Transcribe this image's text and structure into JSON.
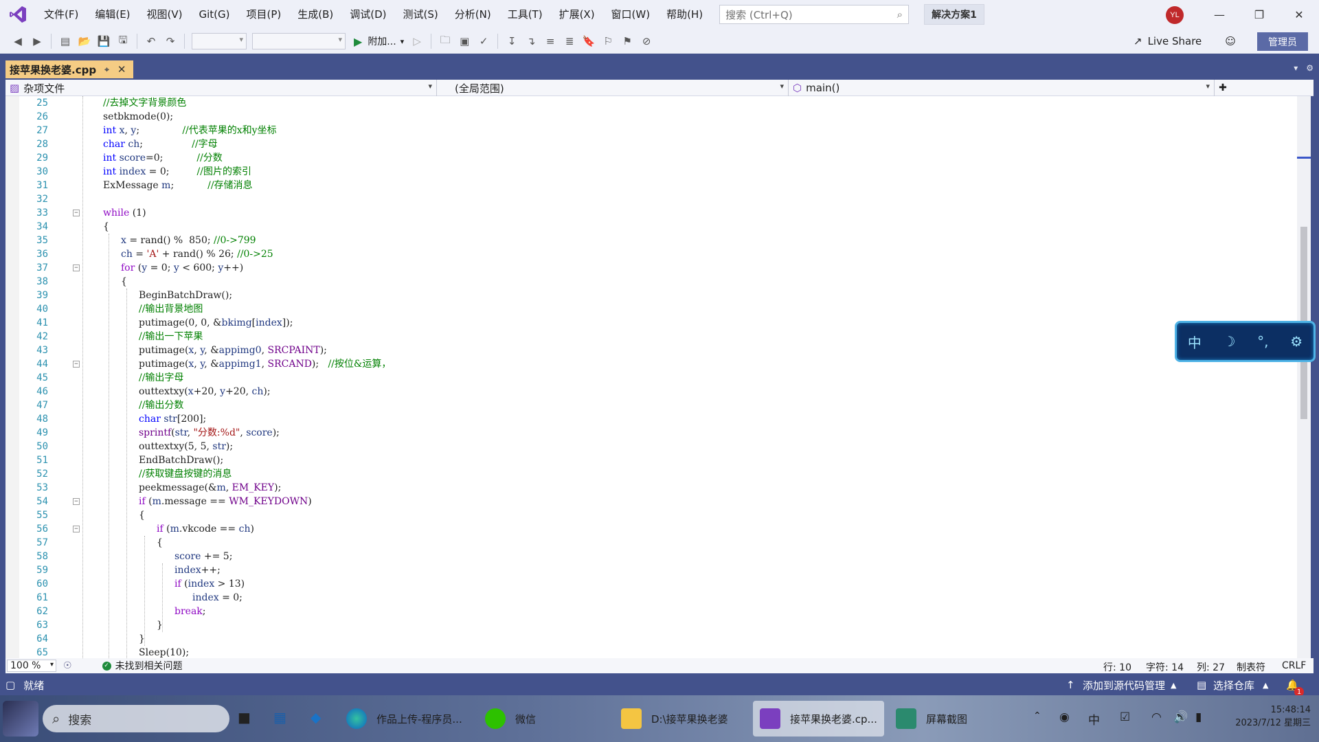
{
  "menu": [
    "文件(F)",
    "编辑(E)",
    "视图(V)",
    "Git(G)",
    "项目(P)",
    "生成(B)",
    "调试(D)",
    "测试(S)",
    "分析(N)",
    "工具(T)",
    "扩展(X)",
    "窗口(W)",
    "帮助(H)"
  ],
  "search": {
    "placeholder": "搜索 (Ctrl+Q)"
  },
  "solution": "解决方案1",
  "user_initials": "YL",
  "toolbar": {
    "attach_label": "附加...",
    "live_share": "Live Share",
    "admin": "管理员"
  },
  "tab": {
    "filename": "接苹果换老婆.cpp"
  },
  "navbar": {
    "project": "杂项文件",
    "scope": "(全局范围)",
    "member": "main()"
  },
  "editor": {
    "lines": [
      {
        "n": "25",
        "fold": false,
        "html": "<span class=\"cm\">//去掉文字背景颜色</span>",
        "indent": 0
      },
      {
        "n": "26",
        "fold": false,
        "html": "setbkmode(0);",
        "indent": 0
      },
      {
        "n": "27",
        "fold": false,
        "html": "<span class=\"kw\">int</span> <span class=\"var\">x</span>, <span class=\"var\">y</span>;              <span class=\"cm\">//代表苹果的x和y坐标</span>",
        "indent": 0
      },
      {
        "n": "28",
        "fold": false,
        "html": "<span class=\"kw\">char</span> <span class=\"var\">ch</span>;                <span class=\"cm\">//字母</span>",
        "indent": 0
      },
      {
        "n": "29",
        "fold": false,
        "html": "<span class=\"kw\">int</span> <span class=\"var\">score</span>=0;           <span class=\"cm\">//分数</span>",
        "indent": 0
      },
      {
        "n": "30",
        "fold": false,
        "html": "<span class=\"kw\">int</span> <span class=\"var\">index</span> = 0;         <span class=\"cm\">//图片的索引</span>",
        "indent": 0
      },
      {
        "n": "31",
        "fold": false,
        "html": "ExMessage <span class=\"var\">m</span>;           <span class=\"cm\">//存储消息</span>",
        "indent": 0
      },
      {
        "n": "32",
        "fold": false,
        "html": "",
        "indent": 0
      },
      {
        "n": "33",
        "fold": true,
        "html": "<span class=\"kw2\">while</span> (1)",
        "indent": 0
      },
      {
        "n": "34",
        "fold": false,
        "html": "{",
        "indent": 0
      },
      {
        "n": "35",
        "fold": false,
        "html": "<span class=\"var\">x</span> = rand() %  850; <span class=\"cm\">//0-&gt;799</span>",
        "indent": 1
      },
      {
        "n": "36",
        "fold": false,
        "html": "<span class=\"var\">ch</span> = <span class=\"str\">'A'</span> + rand() % 26; <span class=\"cm\">//0-&gt;25</span>",
        "indent": 1
      },
      {
        "n": "37",
        "fold": true,
        "html": "<span class=\"kw2\">for</span> (<span class=\"var\">y</span> = 0; <span class=\"var\">y</span> &lt; 600; <span class=\"var\">y</span>++)",
        "indent": 1
      },
      {
        "n": "38",
        "fold": false,
        "html": "{",
        "indent": 1
      },
      {
        "n": "39",
        "fold": false,
        "html": "BeginBatchDraw();",
        "indent": 2
      },
      {
        "n": "40",
        "fold": false,
        "html": "<span class=\"cm\">//输出背景地图</span>",
        "indent": 2
      },
      {
        "n": "41",
        "fold": false,
        "html": "putimage(0, 0, &amp;<span class=\"var\">bkimg</span>[<span class=\"var\">index</span>]);",
        "indent": 2
      },
      {
        "n": "42",
        "fold": false,
        "html": "<span class=\"cm\">//输出一下苹果</span>",
        "indent": 2
      },
      {
        "n": "43",
        "fold": false,
        "html": "putimage(<span class=\"var\">x</span>, <span class=\"var\">y</span>, &amp;<span class=\"var\">appimg0</span>, <span class=\"mac\">SRCPAINT</span>);",
        "indent": 2
      },
      {
        "n": "44",
        "fold": true,
        "html": "putimage(<span class=\"var\">x</span>, <span class=\"var\">y</span>, &amp;<span class=\"var\">appimg1</span>, <span class=\"mac\">SRCAND</span>);   <span class=\"cm\">//按位&amp;运算，</span>",
        "indent": 2
      },
      {
        "n": "45",
        "fold": false,
        "html": "<span class=\"cm\">//输出字母</span>",
        "indent": 2
      },
      {
        "n": "46",
        "fold": false,
        "html": "outtextxy(<span class=\"var\">x</span>+20, <span class=\"var\">y</span>+20, <span class=\"var\">ch</span>);",
        "indent": 2
      },
      {
        "n": "47",
        "fold": false,
        "html": "<span class=\"cm\">//输出分数</span>",
        "indent": 2
      },
      {
        "n": "48",
        "fold": false,
        "html": "<span class=\"kw\">char</span> <span class=\"var\">str</span>[200];",
        "indent": 2
      },
      {
        "n": "49",
        "fold": false,
        "html": "<span class=\"mac\">sprintf</span>(<span class=\"var\">str</span>, <span class=\"str\">\"分数:%d\"</span>, <span class=\"var\">score</span>);",
        "indent": 2
      },
      {
        "n": "50",
        "fold": false,
        "html": "outtextxy(5, 5, <span class=\"var\">str</span>);",
        "indent": 2
      },
      {
        "n": "51",
        "fold": false,
        "html": "EndBatchDraw();",
        "indent": 2
      },
      {
        "n": "52",
        "fold": false,
        "html": "<span class=\"cm\">//获取键盘按键的消息</span>",
        "indent": 2
      },
      {
        "n": "53",
        "fold": false,
        "html": "peekmessage(&amp;<span class=\"var\">m</span>, <span class=\"mac\">EM_KEY</span>);",
        "indent": 2
      },
      {
        "n": "54",
        "fold": true,
        "html": "<span class=\"kw2\">if</span> (<span class=\"var\">m</span>.message == <span class=\"mac\">WM_KEYDOWN</span>)",
        "indent": 2
      },
      {
        "n": "55",
        "fold": false,
        "html": "{",
        "indent": 2
      },
      {
        "n": "56",
        "fold": true,
        "html": "<span class=\"kw2\">if</span> (<span class=\"var\">m</span>.vkcode == <span class=\"var\">ch</span>)",
        "indent": 3
      },
      {
        "n": "57",
        "fold": false,
        "html": "{",
        "indent": 3
      },
      {
        "n": "58",
        "fold": false,
        "html": "<span class=\"var\">score</span> += 5;",
        "indent": 4
      },
      {
        "n": "59",
        "fold": false,
        "html": "<span class=\"var\">index</span>++;",
        "indent": 4
      },
      {
        "n": "60",
        "fold": false,
        "html": "<span class=\"kw2\">if</span> (<span class=\"var\">index</span> &gt; 13)",
        "indent": 4
      },
      {
        "n": "61",
        "fold": false,
        "html": "<span class=\"var\">index</span> = 0;",
        "indent": 5
      },
      {
        "n": "62",
        "fold": false,
        "html": "<span class=\"kw2\">break</span>;",
        "indent": 4
      },
      {
        "n": "63",
        "fold": false,
        "html": "}",
        "indent": 3
      },
      {
        "n": "64",
        "fold": false,
        "html": "}",
        "indent": 2
      },
      {
        "n": "65",
        "fold": false,
        "html": "Sleep(10);",
        "indent": 2
      }
    ]
  },
  "editor_status": {
    "zoom": "100 %",
    "issues": "未找到相关问题",
    "line": "行: 10",
    "char": "字符: 14",
    "col": "列: 27",
    "tabs": "制表符",
    "eol": "CRLF"
  },
  "statusbar": {
    "ready": "就绪",
    "add_source": "添加到源代码管理",
    "select_repo": "选择仓库",
    "notifications": "1"
  },
  "ime": {
    "mode": "中"
  },
  "taskbar": {
    "search": "搜索",
    "apps": [
      "作品上传-程序员...",
      "微信",
      "D:\\接苹果换老婆",
      "接苹果换老婆.cp...",
      "屏幕截图"
    ],
    "lang": "中",
    "time": "15:48:14",
    "date": "2023/7/12 星期三"
  },
  "colors": {
    "accent": "#43528c",
    "tab_active": "#f5cc84",
    "keyword": "#0000ff",
    "control": "#8f08c4",
    "comment": "#008000",
    "string": "#a31515"
  }
}
